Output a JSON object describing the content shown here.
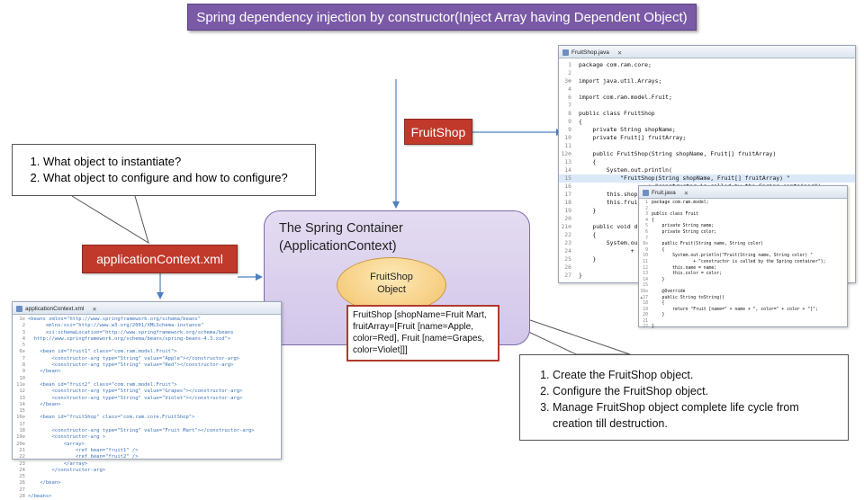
{
  "title": "Spring dependency injection by constructor(Inject Array having Dependent Object)",
  "questions": [
    "What object to instantiate?",
    "What object to configure and how to configure?"
  ],
  "labels": {
    "application_context": "applicationContext.xml",
    "fruitshop": "FruitShop"
  },
  "container": {
    "line1": "The Spring Container",
    "line2": "(ApplicationContext)"
  },
  "oval": {
    "line1": "FruitShop",
    "line2": "Object"
  },
  "object_box": "FruitShop [shopName=Fruit Mart, fruitArray=[Fruit [name=Apple, color=Red], Fruit [name=Grapes, color=Violet]]]",
  "steps": [
    "Create the FruitShop object.",
    "Configure the FruitShop object.",
    "Manage FruitShop object complete life cycle from creation till destruction."
  ],
  "xml_editor": {
    "tab": "applicationContext.xml",
    "lines": [
      {
        "n": "1⊖",
        "t": "<beans xmlns=\"http://www.springframework.org/schema/beans\""
      },
      {
        "n": "2",
        "t": "      xmlns:xsi=\"http://www.w3.org/2001/XMLSchema-instance\""
      },
      {
        "n": "3",
        "t": "      xsi:schemaLocation=\"http://www.springframework.org/schema/beans"
      },
      {
        "n": "4",
        "t": "  http://www.springframework.org/schema/beans/spring-beans-4.3.xsd\">"
      },
      {
        "n": "5",
        "t": ""
      },
      {
        "n": "6⊖",
        "t": "    <bean id=\"fruit1\" class=\"com.ram.model.Fruit\">"
      },
      {
        "n": "7",
        "t": "        <constructor-arg type=\"String\" value=\"Apple\"></constructor-arg>"
      },
      {
        "n": "8",
        "t": "        <constructor-arg type=\"String\" value=\"Red\"></constructor-arg>"
      },
      {
        "n": "9",
        "t": "    </bean>"
      },
      {
        "n": "10",
        "t": ""
      },
      {
        "n": "11⊖",
        "t": "    <bean id=\"fruit2\" class=\"com.ram.model.Fruit\">"
      },
      {
        "n": "12",
        "t": "        <constructor-arg type=\"String\" value=\"Grapes\"></constructor-arg>"
      },
      {
        "n": "13",
        "t": "        <constructor-arg type=\"String\" value=\"Violet\"></constructor-arg>"
      },
      {
        "n": "14",
        "t": "    </bean>"
      },
      {
        "n": "15",
        "t": ""
      },
      {
        "n": "16⊖",
        "t": "    <bean id=\"fruitShop\" class=\"com.ram.core.FruitShop\">"
      },
      {
        "n": "17",
        "t": ""
      },
      {
        "n": "18",
        "t": "        <constructor-arg type=\"String\" value=\"Fruit Mart\"></constructor-arg>"
      },
      {
        "n": "19⊖",
        "t": "        <constructor-arg >"
      },
      {
        "n": "20⊖",
        "t": "            <array>"
      },
      {
        "n": "21",
        "t": "                <ref bean=\"fruit1\" />"
      },
      {
        "n": "22",
        "t": "                <ref bean=\"fruit2\" />"
      },
      {
        "n": "23",
        "t": "            </array>"
      },
      {
        "n": "24",
        "t": "        </constructor-arg>"
      },
      {
        "n": "25",
        "t": ""
      },
      {
        "n": "26",
        "t": "    </bean>"
      },
      {
        "n": "27",
        "t": ""
      },
      {
        "n": "28",
        "t": "</beans>"
      }
    ]
  },
  "java_editor": {
    "tab": "FruitShop.java",
    "lines": [
      {
        "n": "1",
        "t": "package com.ram.core;"
      },
      {
        "n": "2",
        "t": ""
      },
      {
        "n": "3⊕",
        "t": "import java.util.Arrays;"
      },
      {
        "n": "4",
        "t": ""
      },
      {
        "n": "6",
        "t": "import com.ram.model.Fruit;"
      },
      {
        "n": "7",
        "t": ""
      },
      {
        "n": "8",
        "t": "public class FruitShop"
      },
      {
        "n": "9",
        "t": "{"
      },
      {
        "n": "9",
        "t": "    private String shopName;"
      },
      {
        "n": "10",
        "t": "    private Fruit[] fruitArray;"
      },
      {
        "n": "11",
        "t": ""
      },
      {
        "n": "12⊖",
        "t": "    public FruitShop(String shopName, Fruit[] fruitArray)"
      },
      {
        "n": "13",
        "t": "    {"
      },
      {
        "n": "14",
        "t": "        System.out.println("
      },
      {
        "n": "15",
        "t": "            \"FruitShop(String shopName, Fruit[] fruitArray) \""
      },
      {
        "n": "16",
        "t": "                    + \"constructor is called by the Spring container\");"
      },
      {
        "n": "17",
        "t": "        this.shop"
      },
      {
        "n": "18",
        "t": "        this.frui"
      },
      {
        "n": "19",
        "t": "    }"
      },
      {
        "n": "20",
        "t": ""
      },
      {
        "n": "21⊖",
        "t": "    public void d"
      },
      {
        "n": "22",
        "t": "    {"
      },
      {
        "n": "23",
        "t": "        System.ou"
      },
      {
        "n": "24",
        "t": "               +"
      },
      {
        "n": "25",
        "t": "    }"
      },
      {
        "n": "26",
        "t": ""
      },
      {
        "n": "27",
        "t": "}"
      }
    ]
  },
  "fruit_editor": {
    "tab": "Fruit.java",
    "lines": [
      {
        "n": "1",
        "t": "package com.ram.model;"
      },
      {
        "n": "2",
        "t": ""
      },
      {
        "n": "3",
        "t": "public class Fruit"
      },
      {
        "n": "4",
        "t": "{"
      },
      {
        "n": "5",
        "t": "    private String name;"
      },
      {
        "n": "6",
        "t": "    private String color;"
      },
      {
        "n": "7",
        "t": ""
      },
      {
        "n": "8⊖",
        "t": "    public Fruit(String name, String color)"
      },
      {
        "n": "9",
        "t": "    {"
      },
      {
        "n": "10",
        "t": "        System.out.println(\"Fruit(String name, String color) \""
      },
      {
        "n": "11",
        "t": "                + \"constructor is called by the Spring container\");"
      },
      {
        "n": "12",
        "t": "        this.name = name;"
      },
      {
        "n": "13",
        "t": "        this.color = color;"
      },
      {
        "n": "14",
        "t": "    }"
      },
      {
        "n": "15",
        "t": ""
      },
      {
        "n": "16⊖",
        "t": "    @Override"
      },
      {
        "n": "▲17",
        "t": "    public String toString()"
      },
      {
        "n": "18",
        "t": "    {"
      },
      {
        "n": "19",
        "t": "        return \"Fruit [name=\" + name + \", color=\" + color + \"]\";"
      },
      {
        "n": "20",
        "t": "    }"
      },
      {
        "n": "21",
        "t": ""
      },
      {
        "n": "22",
        "t": "}"
      }
    ]
  }
}
